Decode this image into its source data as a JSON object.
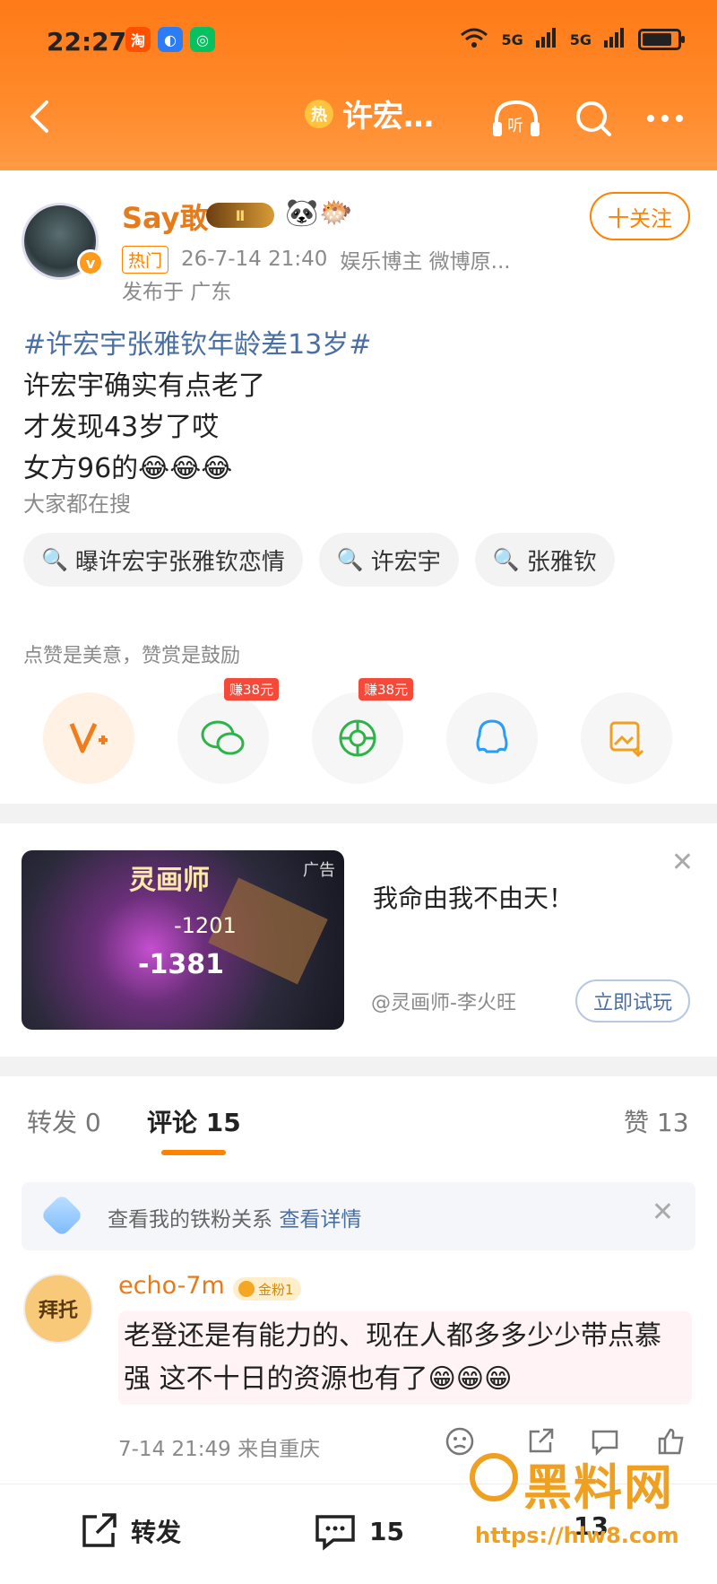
{
  "status_bar": {
    "time": "22:27",
    "network1": "5G",
    "network2": "5G",
    "battery_level": 0.85
  },
  "nav": {
    "title": "许宏…",
    "hot_badge": "热",
    "listen_label": "听"
  },
  "post": {
    "username": "Say敢",
    "level": "Ⅱ",
    "follow_label": "十关注",
    "hot_tag": "热门",
    "datetime": "26-7-14 21:40",
    "role": "娱乐博主 微博原...",
    "location": "发布于 广东",
    "hashtag": "#许宏宇张雅钦年龄差13岁#",
    "lines": [
      "许宏宇确实有点老了",
      "才发现43岁了哎",
      "女方96的😂😂😂"
    ]
  },
  "search": {
    "heading": "大家都在搜",
    "chips": [
      "曝许宏宇张雅钦恋情",
      "许宏宇",
      "张雅钦"
    ]
  },
  "reward": {
    "heading": "点赞是美意，赞赏是鼓励",
    "earn_labels": [
      "赚38元",
      "赚38元"
    ]
  },
  "ad": {
    "game_title": "灵画师",
    "ad_tag": "广告",
    "damage1": "-1381",
    "damage2": "-1201",
    "title": "我命由我不由天！",
    "source": "@灵画师-李火旺",
    "button": "立即试玩"
  },
  "tabs": {
    "repost": "转发 0",
    "comments": "评论 15",
    "likes": "赞 13"
  },
  "fan_banner": {
    "text": "查看我的铁粉关系",
    "link": "查看详情"
  },
  "comment": {
    "avatar_text": "拜托",
    "name": "echo-7m",
    "badge": "金粉1",
    "text": "老登还是有能力的、现在人都多多少少带点慕强 这不十日的资源也有了😁😁😁",
    "time": "7-14 21:49",
    "from": "来自重庆"
  },
  "bottom_bar": {
    "repost": "转发",
    "comments": "15",
    "likes": "13"
  },
  "watermark": {
    "title": "黑料网",
    "url": "https://hlw8.com"
  }
}
